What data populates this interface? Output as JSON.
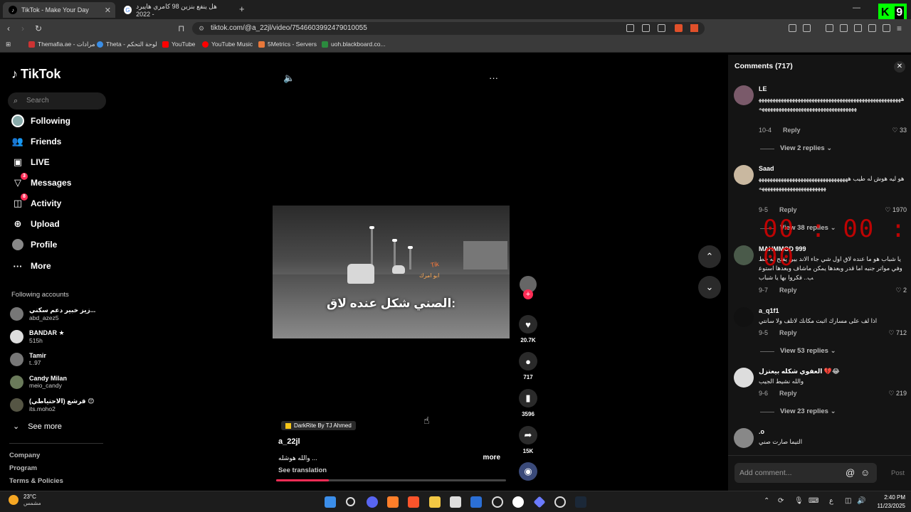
{
  "browser": {
    "tabs": [
      {
        "title": "TikTok - Make Your Day",
        "active": true
      },
      {
        "title": "هل ينفع بنزين 98 كامري هايبرد 2022 -",
        "active": false
      }
    ],
    "new_tab": "+",
    "url": "tiktok.com/@a_22jl/video/7546603992479010055",
    "bookmarks": [
      "Themafia.ae - مرادات",
      "Theta - لوحة التحكم",
      "YouTube",
      "YouTube Music",
      "5Metrics - Servers",
      "uoh.blackboard.co..."
    ],
    "overlay_badge": {
      "k": "K",
      "n": "9"
    }
  },
  "sidebar": {
    "logo": "TikTok",
    "search_placeholder": "Search",
    "nav": [
      {
        "label": "Following",
        "icon": "following-avatar-icon",
        "badge": ""
      },
      {
        "label": "Friends",
        "icon": "friends-icon",
        "badge": ""
      },
      {
        "label": "LIVE",
        "icon": "live-icon",
        "badge": ""
      },
      {
        "label": "Messages",
        "icon": "messages-icon",
        "badge": "3"
      },
      {
        "label": "Activity",
        "icon": "activity-icon",
        "badge": "8"
      },
      {
        "label": "Upload",
        "icon": "upload-icon",
        "badge": ""
      },
      {
        "label": "Profile",
        "icon": "profile-icon",
        "badge": ""
      },
      {
        "label": "More",
        "icon": "more-icon",
        "badge": ""
      }
    ],
    "following_title": "Following accounts",
    "accounts": [
      {
        "name": "زيز خبير دعم سكني...",
        "handle": "abd_azez5"
      },
      {
        "name": "BANDAR ★",
        "handle": "515h"
      },
      {
        "name": "Tamir",
        "handle": "t..97"
      },
      {
        "name": "Candy Milan",
        "handle": "meio_candy"
      },
      {
        "name": "قرشع (الاحتياطي) 😊",
        "handle": "its.moho2"
      }
    ],
    "see_more": "See more",
    "footer": [
      "Company",
      "Program",
      "Terms & Policies"
    ]
  },
  "video": {
    "caption": "الصني شكل عنده لاق:",
    "watermark1": "Tik",
    "watermark2": "ابو امرك",
    "music": "DarkRite By TJ Ahmed",
    "author": "a_22jl",
    "description": "والله هوشله ...",
    "more": "more",
    "see_translation": "See translation",
    "progress": 0.23,
    "actions": {
      "likes": "20.7K",
      "comments": "717",
      "saves": "3596",
      "shares": "15K"
    }
  },
  "comments": {
    "title": "Comments (717)",
    "items": [
      {
        "user": "LE",
        "text": "ههههههههههههههههههههههههههههههههههههههههههههههههههههههههههههههههههههههههههههههههههههههه",
        "date": "10-4",
        "reply": "Reply",
        "likes": "33",
        "view_replies": "View 2 replies"
      },
      {
        "user": "Saad",
        "text": "هو ليه هوش له طيب ههههههههههههههههههههههههههههههههههههههههههههههههههههههههه",
        "date": "9-5",
        "reply": "Reply",
        "likes": "1970",
        "view_replies": "View 38 replies"
      },
      {
        "user": "MAHMMOD 999",
        "text": "يا شباب هو ما عنده لاق اول شي جاء الاند بيي يفتح له خط وفي مواتر جنبه اما قدر وبعدها يمكن ماشاف وبعدها استوعب.. فكروا بها يا شباب",
        "date": "9-7",
        "reply": "Reply",
        "likes": "2",
        "view_replies": ""
      },
      {
        "user": "a_q1f1",
        "text": "اذا لف على مسارك اثبت مكانك لاتلف ولا سانتي",
        "date": "9-5",
        "reply": "Reply",
        "likes": "712",
        "view_replies": "View 53 replies"
      },
      {
        "user": "العفوي شكله بيعتزل 💔😂",
        "text": "والله نشيط الجيب",
        "date": "9-6",
        "reply": "Reply",
        "likes": "219",
        "view_replies": "View 23 replies"
      },
      {
        "user": ".o",
        "text": "التيما صارت صني",
        "date": "",
        "reply": "",
        "likes": "",
        "view_replies": ""
      }
    ],
    "timer": "00 : 00 : 00",
    "add_placeholder": "Add comment...",
    "post": "Post"
  },
  "taskbar": {
    "temp": "23°C",
    "weather": "مشمس",
    "time": "2:40 PM",
    "date": "11/23/2025",
    "lang": "ع"
  }
}
